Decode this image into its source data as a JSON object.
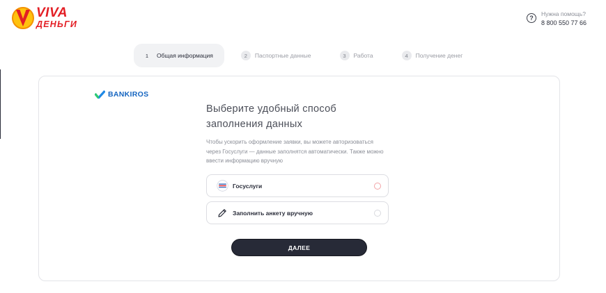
{
  "brand": {
    "name_top": "VIVA",
    "name_bottom": "ДЕНЬГИ",
    "color": "#e31e24"
  },
  "help": {
    "icon": "question-circle-icon",
    "label": "Нужна помощь?",
    "phone": "8 800 550 77 66"
  },
  "steps": [
    {
      "number": "1",
      "label": "Общая информация",
      "active": true
    },
    {
      "number": "2",
      "label": "Паспортные данные",
      "active": false
    },
    {
      "number": "3",
      "label": "Работа",
      "active": false
    },
    {
      "number": "4",
      "label": "Получение денег",
      "active": false
    }
  ],
  "partner": {
    "name": "BANKIROS",
    "icon": "bankiros-check-icon",
    "color": "#1565c0"
  },
  "form": {
    "title_line1": "Выберите удобный способ",
    "title_line2": "заполнения данных",
    "desc_line1": "Чтобы ускорить оформление заявки, вы можете авторизоваться",
    "desc_line2": "через Госуслуги — данные заполнятся автоматически. Также можно",
    "desc_line3": "ввести информацию вручную",
    "options": [
      {
        "label": "Госуслуги",
        "icon": "gosuslugi-icon",
        "selected": false
      },
      {
        "label": "Заполнить анкету вручную",
        "icon": "pencil-icon",
        "selected": false
      }
    ],
    "submit_label": "ДАЛЕЕ",
    "button_color": "#272a37"
  }
}
